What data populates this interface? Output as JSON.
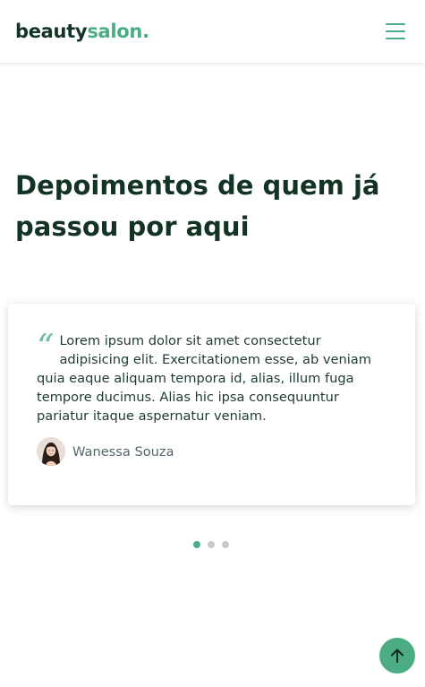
{
  "header": {
    "logo_part1": "beauty",
    "logo_part2": "salon.",
    "menu_icon": "hamburger-menu-icon"
  },
  "section": {
    "title": "Depoimentos de quem já passou por aqui"
  },
  "testimonial": {
    "quote_icon": "quote-icon",
    "text": "Lorem ipsum dolor sit amet consectetur adipisicing elit. Exercitationem esse, ab veniam quia eaque aliquam tempora id, alias, illum fuga tempore ducimus. Alias hic ipsa consequuntur pariatur itaque aspernatur veniam.",
    "author": "Wanessa Souza"
  },
  "carousel": {
    "slide_count": 3,
    "active_index": 0
  },
  "back_to_top_icon": "arrow-up-icon",
  "colors": {
    "brand_dark": "#133325",
    "brand_accent": "#4cad85",
    "dot_inactive": "#c7cbc9"
  }
}
